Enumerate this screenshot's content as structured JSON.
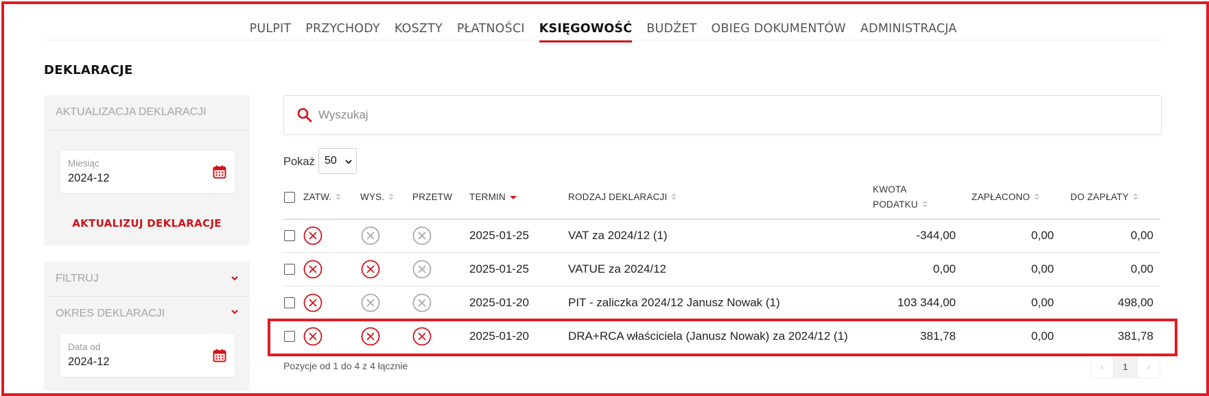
{
  "nav": {
    "items": [
      {
        "label": "PULPIT",
        "active": false
      },
      {
        "label": "PRZYCHODY",
        "active": false
      },
      {
        "label": "KOSZTY",
        "active": false
      },
      {
        "label": "PŁATNOŚCI",
        "active": false
      },
      {
        "label": "KSIĘGOWOŚĆ",
        "active": true
      },
      {
        "label": "BUDŻET",
        "active": false
      },
      {
        "label": "OBIEG DOKUMENTÓW",
        "active": false
      },
      {
        "label": "ADMINISTRACJA",
        "active": false
      }
    ]
  },
  "page": {
    "title": "DEKLARACJE"
  },
  "sidebar": {
    "update_panel": {
      "title": "AKTUALIZACJA DEKLARACJI",
      "month_label": "Miesiąc",
      "month_value": "2024-12",
      "button_label": "AKTUALIZUJ DEKLARACJE"
    },
    "filter_panel": {
      "title": "FILTRUJ",
      "period_title": "OKRES DEKLARACJI",
      "date_from_label": "Data od",
      "date_from_value": "2024-12"
    }
  },
  "search": {
    "placeholder": "Wyszukaj",
    "value": "",
    "icon": "search-icon"
  },
  "page_size": {
    "label": "Pokaż",
    "value": "50"
  },
  "table": {
    "headers": {
      "approved": "ZATW.",
      "sent": "WYS.",
      "processed": "PRZETW",
      "deadline": "TERMIN",
      "type": "RODZAJ DEKLARACJI",
      "tax_amount_line1": "KWOTA",
      "tax_amount_line2": "PODATKU",
      "paid": "ZAPŁACONO",
      "to_pay": "DO ZAPŁATY"
    },
    "rows": [
      {
        "approved": false,
        "sent": false,
        "processed": false,
        "deadline": "2025-01-25",
        "type": "VAT za 2024/12 (1)",
        "tax_amount": "-344,00",
        "paid": "0,00",
        "to_pay": "0,00"
      },
      {
        "approved": false,
        "sent": false,
        "processed": false,
        "deadline": "2025-01-25",
        "type": "VATUE za 2024/12",
        "tax_amount": "0,00",
        "paid": "0,00",
        "to_pay": "0,00"
      },
      {
        "approved": false,
        "sent": false,
        "processed": false,
        "deadline": "2025-01-20",
        "type": "PIT - zaliczka 2024/12 Janusz Nowak (1)",
        "tax_amount": "103 344,00",
        "paid": "0,00",
        "to_pay": "498,00"
      },
      {
        "approved": false,
        "sent": false,
        "processed": false,
        "deadline": "2025-01-20",
        "type": "DRA+RCA właściciela (Janusz Nowak) za 2024/12 (1)",
        "tax_amount": "381,78",
        "paid": "0,00",
        "to_pay": "381,78"
      }
    ],
    "footer": "Pozycje od 1 do 4 z 4 łącznie",
    "pagination": {
      "prev": "‹",
      "current": "1",
      "next": "›"
    }
  },
  "colors": {
    "accent": "#d0141b",
    "highlight": "#e11b22",
    "muted_icon": "#aaaaaa"
  }
}
